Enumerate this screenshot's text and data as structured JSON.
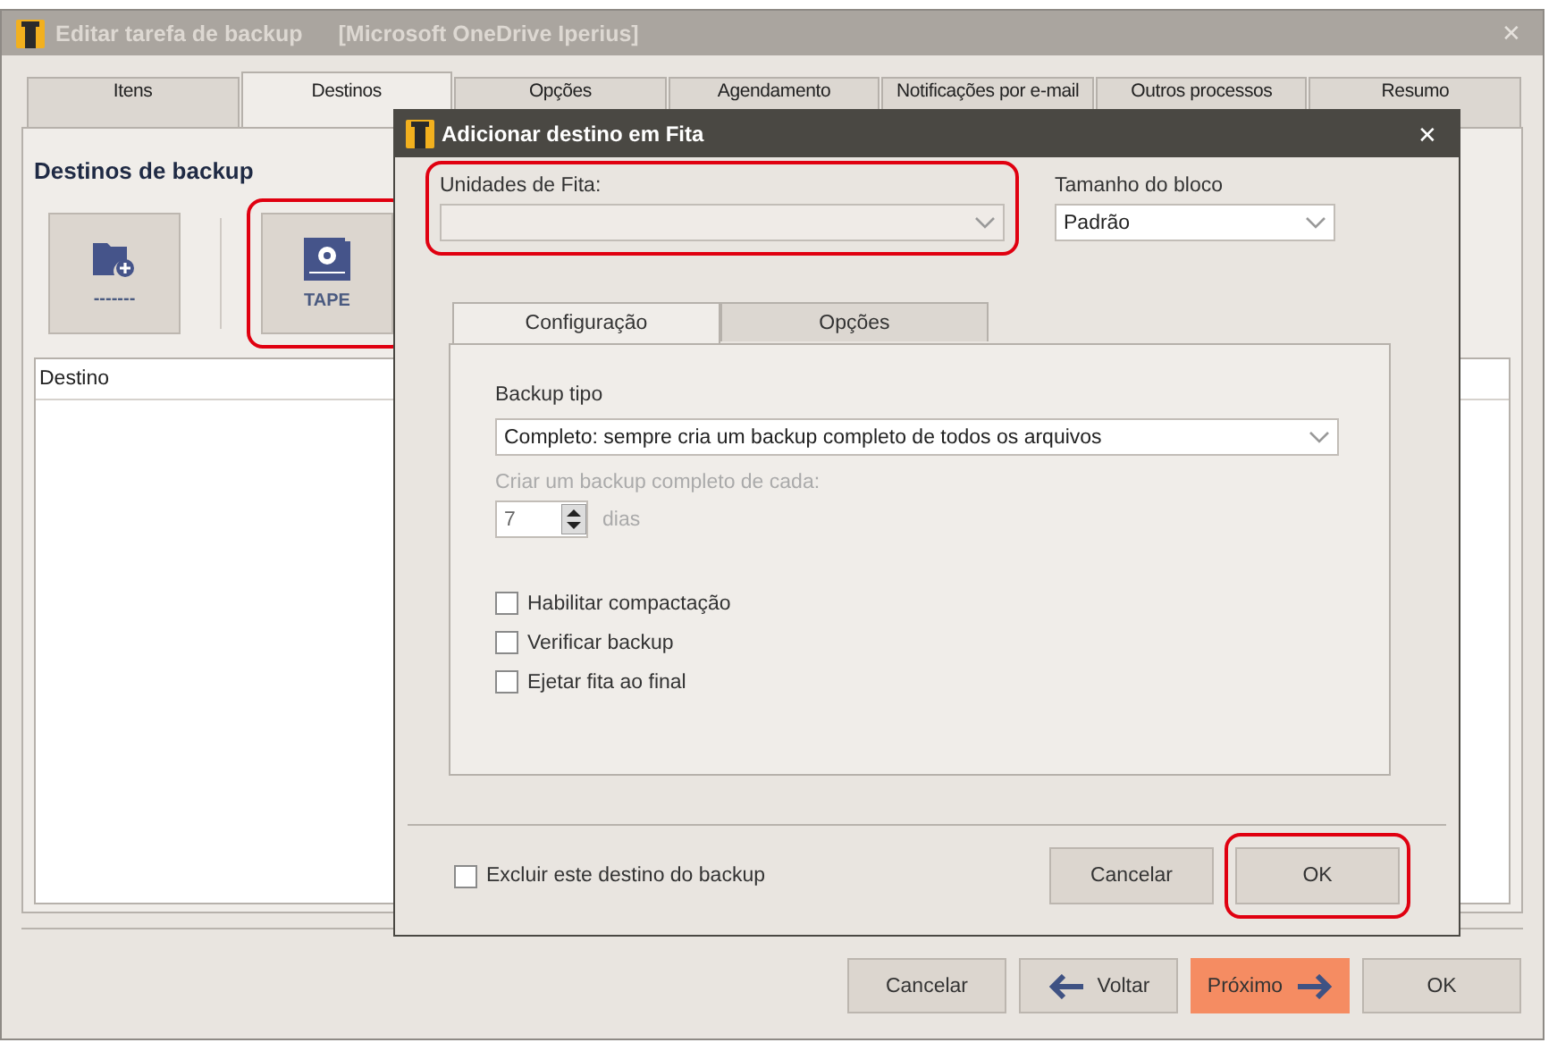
{
  "window": {
    "title": "Editar tarefa de backup",
    "subtitle": "[Microsoft OneDrive Iperius]",
    "close": "✕"
  },
  "tabs": [
    {
      "label": "Itens",
      "selected": false
    },
    {
      "label": "Destinos",
      "selected": true
    },
    {
      "label": "Opções",
      "selected": false
    },
    {
      "label": "Agendamento",
      "selected": false
    },
    {
      "label": "Notificações por e-mail",
      "selected": false
    },
    {
      "label": "Outros processos",
      "selected": false
    },
    {
      "label": "Resumo",
      "selected": false
    }
  ],
  "destinations": {
    "heading": "Destinos de backup",
    "buttons": [
      {
        "kind": "folder",
        "label": "-------",
        "highlighted": false
      },
      {
        "kind": "tape",
        "label": "TAPE",
        "highlighted": true
      }
    ],
    "table": {
      "columns": [
        "Destino"
      ]
    }
  },
  "footer_buttons": [
    {
      "kind": "plain",
      "label": "Cancelar"
    },
    {
      "kind": "back",
      "label": "Voltar"
    },
    {
      "kind": "next",
      "label": "Próximo"
    },
    {
      "kind": "plain",
      "label": "OK"
    }
  ],
  "dialog": {
    "title": "Adicionar destino em Fita",
    "close": "✕",
    "tape_units": {
      "label": "Unidades de Fita:",
      "disabled": true,
      "highlighted": true
    },
    "block_size": {
      "label": "Tamanho do bloco",
      "value": "Padrão"
    },
    "tabs": [
      {
        "label": "Configuração",
        "selected": true
      },
      {
        "label": "Opções",
        "selected": false
      }
    ],
    "backup_type": {
      "label": "Backup tipo",
      "value": "Completo: sempre cria um backup completo de todos os arquivos"
    },
    "full_every": {
      "label": "Criar um backup completo de cada:",
      "value": "7",
      "unit": "dias",
      "disabled": true
    },
    "checkboxes": [
      {
        "label": "Habilitar compactação",
        "checked": false
      },
      {
        "label": "Verificar backup",
        "checked": false
      },
      {
        "label": "Ejetar fita ao final",
        "checked": false
      }
    ],
    "exclude": {
      "label": "Excluir este destino do backup",
      "checked": false
    },
    "buttons": [
      {
        "label": "Cancelar",
        "highlighted": false
      },
      {
        "label": "OK",
        "highlighted": true
      }
    ]
  }
}
